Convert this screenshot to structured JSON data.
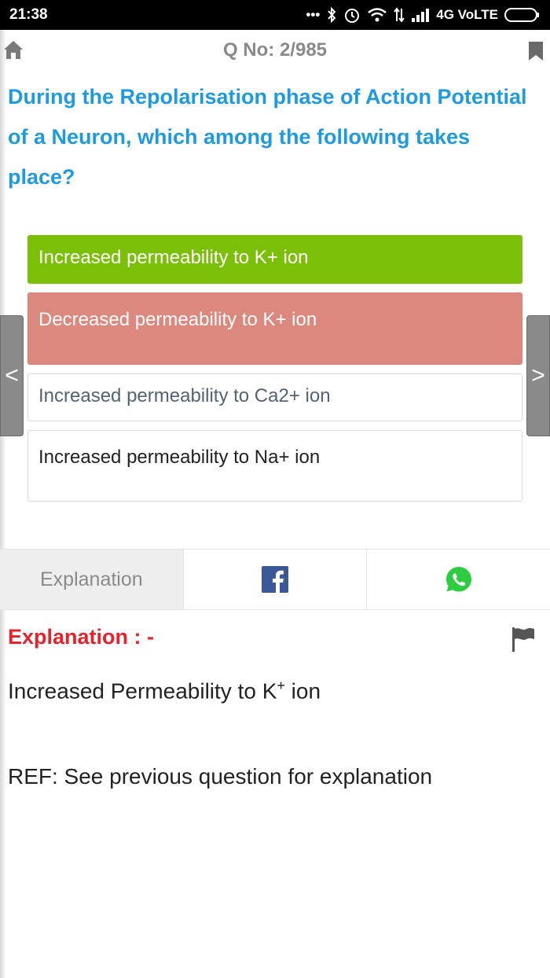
{
  "status_bar": {
    "time": "21:38",
    "network": "4G VoLTE"
  },
  "header": {
    "question_number": "Q No: 2/985",
    "home_icon": "home-icon",
    "bookmark_icon": "bookmark-icon"
  },
  "question": {
    "text": "During the Repolarisation phase of Action Potential of a Neuron, which among the following takes place?"
  },
  "options": [
    {
      "label": "Increased permeability to K+ ion",
      "state": "correct"
    },
    {
      "label": "Decreased permeability to K+ ion",
      "state": "wrong"
    },
    {
      "label": "Increased permeability to Ca2+ ion",
      "state": "neutral"
    },
    {
      "label": "Increased permeability to Na+ ion",
      "state": "neutral"
    }
  ],
  "nav": {
    "prev": "<",
    "next": ">"
  },
  "tabs": {
    "explanation_label": "Explanation",
    "facebook_icon": "facebook-icon",
    "whatsapp_icon": "whatsapp-icon"
  },
  "explanation": {
    "heading": "Explanation : -",
    "line1_main": "Increased Permeability to K",
    "line1_sup": "+",
    "line1_end": " ion",
    "line2": "REF: See previous question for explanation",
    "flag_icon": "flag-icon"
  },
  "colors": {
    "correct": "#7bbf09",
    "wrong": "#dd887e",
    "question": "#1e9be0",
    "heading": "#e8212b"
  }
}
